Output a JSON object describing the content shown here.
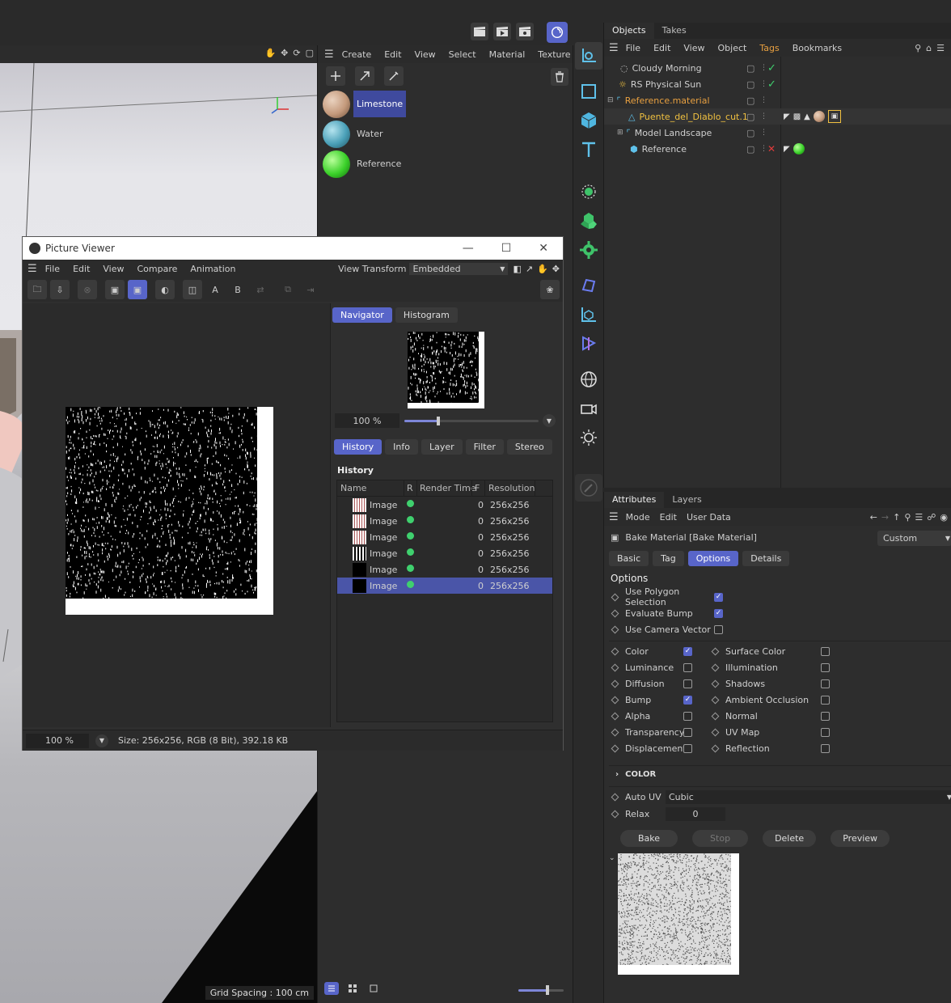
{
  "objects_panel": {
    "tabs": [
      "Objects",
      "Takes"
    ],
    "menu": [
      "File",
      "Edit",
      "View",
      "Object",
      "Tags",
      "Bookmarks"
    ],
    "items": [
      {
        "label": "Cloudy Morning",
        "color": "#cfcfcf"
      },
      {
        "label": "RS Physical Sun",
        "color": "#cfcfcf"
      },
      {
        "label": "Reference.material",
        "color": "#e8a040"
      },
      {
        "label": "Puente_del_Diablo_cut.1",
        "color": "#f0c040"
      },
      {
        "label": "Model Landscape",
        "color": "#cfcfcf"
      },
      {
        "label": "Reference",
        "color": "#cfcfcf"
      }
    ]
  },
  "material_manager": {
    "menu": [
      "Create",
      "Edit",
      "View",
      "Select",
      "Material",
      "Texture"
    ],
    "materials": [
      {
        "label": "Limestone",
        "selected": true,
        "color": "#c49a7c"
      },
      {
        "label": "Water",
        "selected": false,
        "color": "#4aa0b8"
      },
      {
        "label": "Reference",
        "selected": false,
        "color": "#3bd12a"
      }
    ]
  },
  "viewport": {
    "grid_spacing": "Grid Spacing : 100 cm"
  },
  "picture_viewer": {
    "title": "Picture Viewer",
    "menu": [
      "File",
      "Edit",
      "View",
      "Compare",
      "Animation"
    ],
    "view_transform_label": "View Transform",
    "view_transform_value": "Embedded",
    "nav_tabs": [
      "Navigator",
      "Histogram"
    ],
    "zoom": "100 %",
    "zoom_slider_fraction": 0.25,
    "hist_tabs": [
      "History",
      "Info",
      "Layer",
      "Filter",
      "Stereo"
    ],
    "history_heading": "History",
    "columns": [
      "Name",
      "R",
      "Render Time",
      "F",
      "Resolution"
    ],
    "rows": [
      {
        "name": "Image",
        "f": "0",
        "res": "256x256",
        "selected": false
      },
      {
        "name": "Image",
        "f": "0",
        "res": "256x256",
        "selected": false
      },
      {
        "name": "Image",
        "f": "0",
        "res": "256x256",
        "selected": false
      },
      {
        "name": "Image",
        "f": "0",
        "res": "256x256",
        "selected": false
      },
      {
        "name": "Image",
        "f": "0",
        "res": "256x256",
        "selected": false
      },
      {
        "name": "Image",
        "f": "0",
        "res": "256x256",
        "selected": true
      }
    ],
    "status_zoom": "100 %",
    "status_text": "Size: 256x256, RGB (8 Bit), 392.18 KB",
    "letter_a": "A",
    "letter_b": "B"
  },
  "attributes": {
    "tabs": [
      "Attributes",
      "Layers"
    ],
    "menu": [
      "Mode",
      "Edit",
      "User Data"
    ],
    "object_title": "Bake Material [Bake Material]",
    "preset": "Custom",
    "subtabs": [
      "Basic",
      "Tag",
      "Options",
      "Details"
    ],
    "active_subtab": "Options",
    "section_title": "Options",
    "options_top": [
      {
        "label": "Use Polygon Selection",
        "checked": true
      },
      {
        "label": "Evaluate Bump",
        "checked": true
      },
      {
        "label": "Use Camera Vector",
        "checked": false
      }
    ],
    "options_left": [
      {
        "label": "Color",
        "checked": true
      },
      {
        "label": "Luminance",
        "checked": false
      },
      {
        "label": "Diffusion",
        "checked": false
      },
      {
        "label": "Bump",
        "checked": true
      },
      {
        "label": "Alpha",
        "checked": false
      },
      {
        "label": "Transparency",
        "checked": false
      },
      {
        "label": "Displacement",
        "checked": false
      }
    ],
    "options_right": [
      {
        "label": "Surface Color",
        "checked": false
      },
      {
        "label": "Illumination",
        "checked": false
      },
      {
        "label": "Shadows",
        "checked": false
      },
      {
        "label": "Ambient Occlusion",
        "checked": false
      },
      {
        "label": "Normal",
        "checked": false
      },
      {
        "label": "UV Map",
        "checked": false
      },
      {
        "label": "Reflection",
        "checked": false
      }
    ],
    "color_group": "COLOR",
    "auto_uv_label": "Auto UV",
    "auto_uv_value": "Cubic",
    "relax_label": "Relax",
    "relax_value": "0",
    "buttons": [
      "Bake",
      "Stop",
      "Delete",
      "Preview"
    ]
  }
}
